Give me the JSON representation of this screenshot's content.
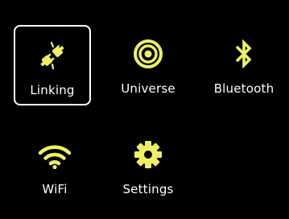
{
  "theme": {
    "background": "#000000",
    "icon_color": "#EEF062",
    "label_color": "#FFFFFF",
    "selection_border": "#FFFFFF"
  },
  "menu": {
    "selected": "Linking",
    "items": [
      {
        "label": "Linking",
        "icon": "plug-link-icon"
      },
      {
        "label": "Universe",
        "icon": "target-rings-icon"
      },
      {
        "label": "Bluetooth",
        "icon": "bluetooth-icon"
      },
      {
        "label": "WiFi",
        "icon": "wifi-icon"
      },
      {
        "label": "Settings",
        "icon": "gear-icon"
      }
    ]
  }
}
